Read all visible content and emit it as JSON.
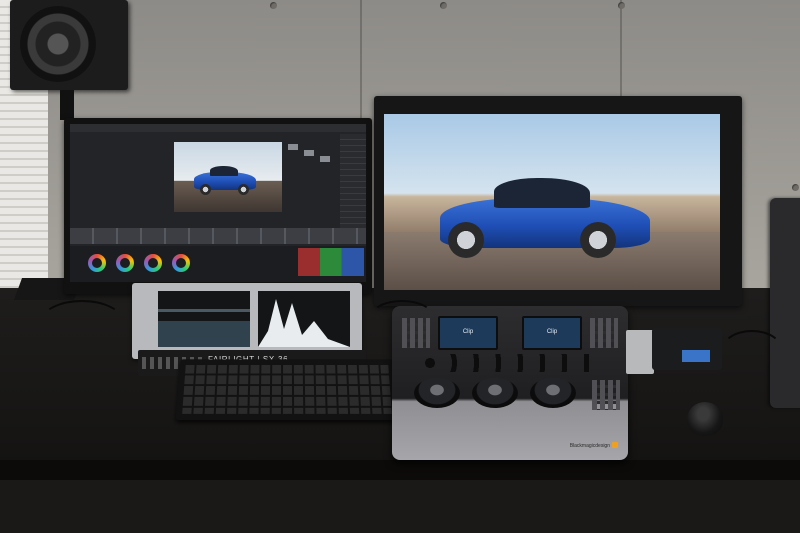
{
  "scene": {
    "left_monitor_label": "",
    "fairlight_label": "FAIRLIGHT | SX-36",
    "panel_screen_left": "Clip",
    "panel_screen_right": "Clip",
    "panel_brand": "Blackmagicdesign"
  },
  "colors": {
    "car_blue": "#1f4fb6",
    "desk": "#161514",
    "wall": "#a19e98",
    "panel_accent": "#f0a020"
  },
  "icons": [
    "speaker-icon",
    "color-wheel-icon",
    "trackball-icon",
    "mouse-icon"
  ]
}
